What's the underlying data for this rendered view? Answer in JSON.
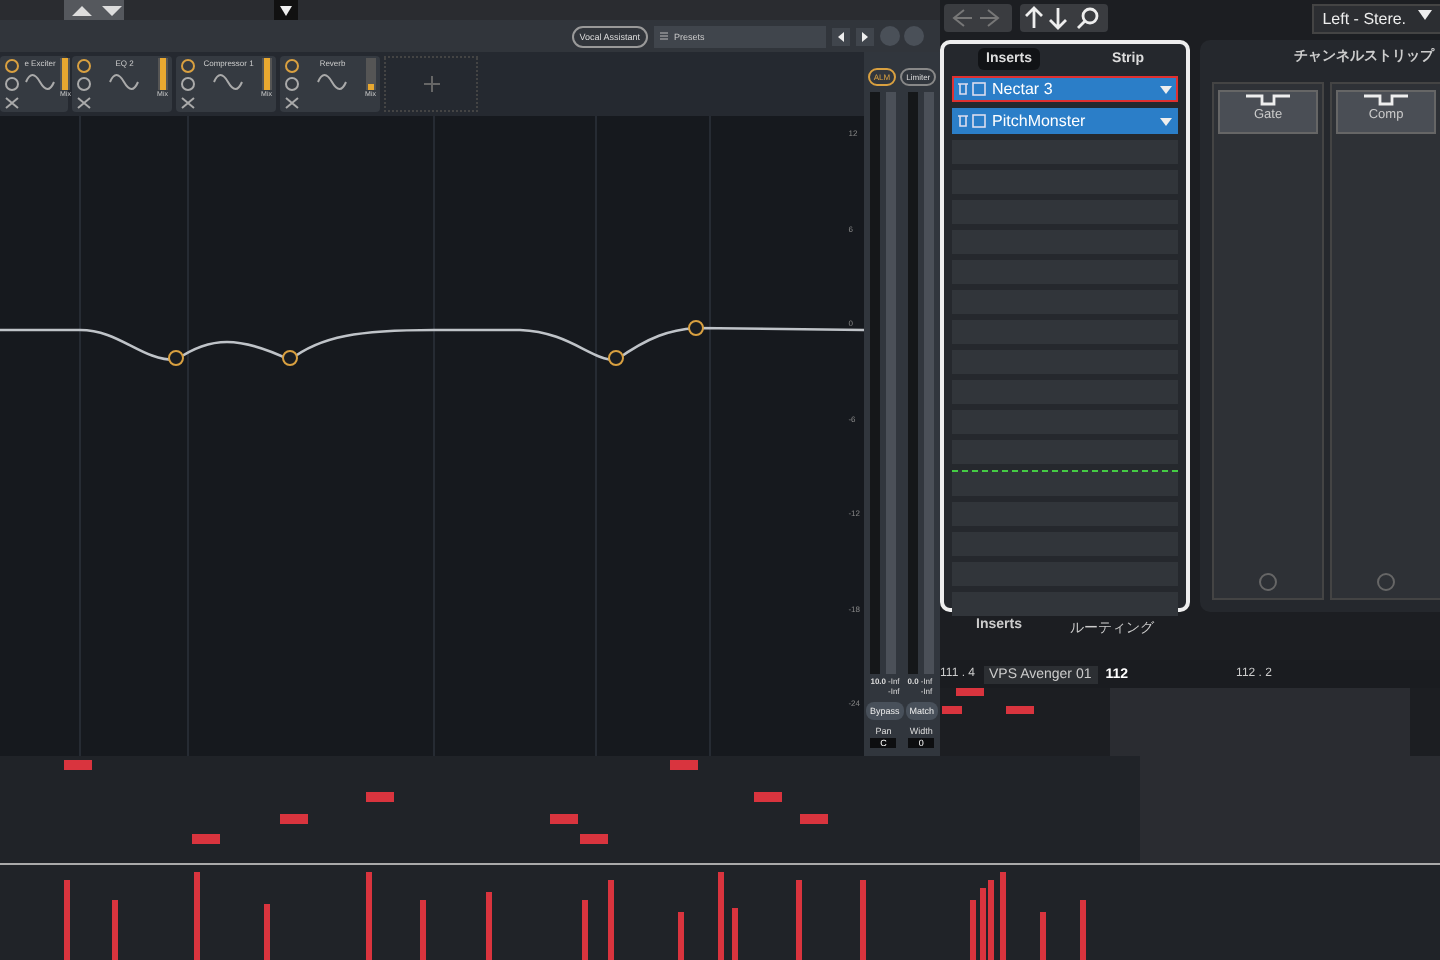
{
  "modules": [
    {
      "name": "e Exciter",
      "mix": "Mix",
      "level": 1
    },
    {
      "name": "EQ 2",
      "mix": "Mix",
      "level": 1
    },
    {
      "name": "Compressor 1",
      "mix": "Mix",
      "level": 1
    },
    {
      "name": "Reverb",
      "mix": "Mix",
      "level": 0.2
    }
  ],
  "toolbar": {
    "assistant": "Vocal Assistant",
    "presets": "Presets"
  },
  "scale": [
    "12",
    "6",
    "0",
    "-6",
    "-12",
    "-18",
    "-24"
  ],
  "meter": {
    "modes": [
      {
        "label": "ALM",
        "selected": true
      },
      {
        "label": "Limiter",
        "selected": false
      }
    ],
    "readouts": [
      {
        "value": "10.0",
        "peak": "-Inf",
        "rms": "-Inf"
      },
      {
        "value": "0.0",
        "peak": "-Inf",
        "rms": "-Inf"
      }
    ],
    "buttons": [
      "Bypass",
      "Match"
    ],
    "knobs": [
      {
        "label": "Pan",
        "value": "C"
      },
      {
        "label": "Width",
        "value": "0"
      }
    ]
  },
  "output": "Left - Stere.",
  "inserts": {
    "tabs": [
      {
        "label": "Inserts",
        "selected": true
      },
      {
        "label": "Strip",
        "selected": false
      }
    ],
    "slots": [
      {
        "name": "Nectar 3",
        "selected": true
      },
      {
        "name": "PitchMonster",
        "selected": false
      }
    ],
    "bottom_tabs": [
      {
        "label": "Inserts",
        "selected": true
      },
      {
        "label": "ルーティング",
        "selected": false
      }
    ]
  },
  "strip": {
    "title": "チャンネルストリップ",
    "modules": [
      "Gate",
      "Comp"
    ]
  },
  "ruler": {
    "left": "111 . 4",
    "track": "VPS Avenger 01",
    "bar": "112",
    "right": "112 . 2"
  }
}
